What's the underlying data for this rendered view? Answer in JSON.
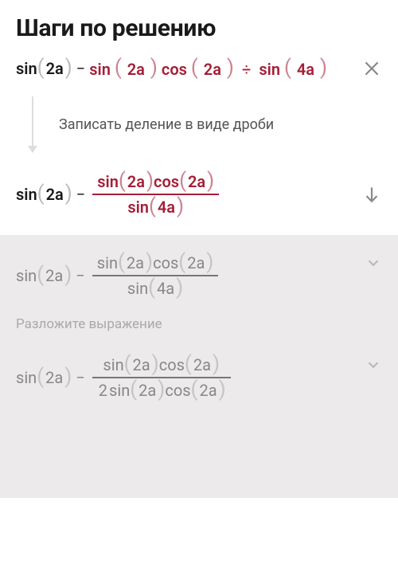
{
  "title": "Шаги по решению",
  "step1": {
    "part1": {
      "fn": "sin",
      "arg": "2a"
    },
    "minus": "−",
    "part2": {
      "fn1": "sin",
      "arg1": "2a",
      "fn2": "cos",
      "arg2": "2a",
      "div": "÷",
      "fn3": "sin",
      "arg3": "4a"
    }
  },
  "hint1": "Записать деление в виде дроби",
  "step2": {
    "left": {
      "fn": "sin",
      "arg": "2a"
    },
    "minus": "−",
    "num": {
      "fn1": "sin",
      "arg1": "2a",
      "fn2": "cos",
      "arg2": "2a"
    },
    "den": {
      "fn": "sin",
      "arg": "4a"
    }
  },
  "faded": {
    "step3": {
      "left": {
        "fn": "sin",
        "arg": "2a"
      },
      "minus": "−",
      "num": {
        "fn1": "sin",
        "arg1": "2a",
        "fn2": "cos",
        "arg2": "2a"
      },
      "den": {
        "fn": "sin",
        "arg": "4a"
      }
    },
    "hint2": "Разложите выражение",
    "step4": {
      "left": {
        "fn": "sin",
        "arg": "2a"
      },
      "minus": "−",
      "num": {
        "fn1": "sin",
        "arg1": "2a",
        "fn2": "cos",
        "arg2": "2a"
      },
      "den": {
        "two": "2",
        "fn1": "sin",
        "arg1": "2a",
        "fn2": "cos",
        "arg2": "2a"
      }
    }
  },
  "parens": {
    "open": "(",
    "close": ")"
  }
}
